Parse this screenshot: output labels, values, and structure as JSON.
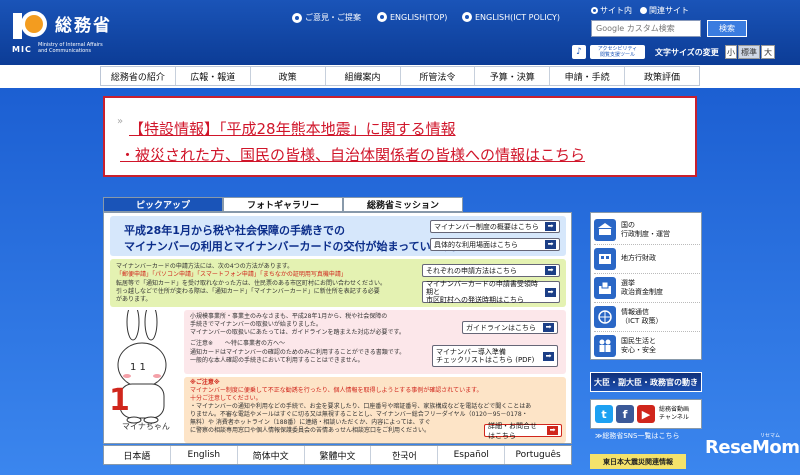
{
  "header": {
    "ministry_name": "総務省",
    "ministry_short": "MIC",
    "ministry_en_1": "Ministry of Internal Affairs",
    "ministry_en_2": "and Communications",
    "links": [
      {
        "label": "ご意見・ご提案"
      },
      {
        "label": "ENGLISH(TOP)"
      },
      {
        "label": "ENGLISH(ICT POLICY)"
      }
    ],
    "search_scope": [
      {
        "label": "サイト内",
        "selected": true
      },
      {
        "label": "関連サイト",
        "selected": false
      }
    ],
    "search_placeholder": "Google カスタム検索",
    "search_button": "検索",
    "accessibility_tool_1": "アクセシビリティ",
    "accessibility_tool_2": "閲覧支援ツール",
    "font_size_label": "文字サイズの変更",
    "font_sizes": [
      "小",
      "標準",
      "大"
    ]
  },
  "nav": [
    "総務省の紹介",
    "広報・報道",
    "政策",
    "組織案内",
    "所管法令",
    "予算・決算",
    "申請・手続",
    "政策評価"
  ],
  "alert": {
    "line1": "【特設情報】「平成28年熊本地震」に関する情報",
    "line2": "・被災された方、国民の皆様、自治体関係者の皆様への情報はこちら"
  },
  "tabs": [
    "ピックアップ",
    "フォトギャラリー",
    "総務省ミッション"
  ],
  "pickup": {
    "headline_1": "平成28年1月から税や社会保障の手続きでの",
    "headline_2": "マイナンバーの利用とマイナンバーカードの交付が始まっています。",
    "link_overview": "マイナンバー制度の概要はこちら",
    "link_scenes": "具体的な利用場面はこちら",
    "green_text": [
      "マイナンバーカードの申請方法には、次の4つの方法があります。",
      "「郵便申請」「パソコン申請」「スマートフォン申請」「まちなかの証明用写真機申請」",
      "転居等で「通知カード」を受け取れなかった方は、住民票のある市区町村にお問い合わせください。",
      "引っ越しなどで住所が変わる際は、「通知カード」「マイナンバーカード」に新住所を表記する必要",
      "があります。"
    ],
    "link_methods": "それぞれの申請方法はこちら",
    "link_receive_1": "マイナンバーカードの申請書受領時期と",
    "link_receive_2": "市区町村への発送時期はこちら",
    "pink_text": [
      "小規模事業所・事業主のみなさまも、平成28年1月から、税や社会保障の",
      "手続きでマイナンバーの取扱いが始まりました。",
      "マイナンバーの取扱いにあたっては、ガイドラインを踏まえた対応が必要です。"
    ],
    "link_guideline": "ガイドラインはこちら",
    "pink_note_title": "ご注意※　　～特に事業者の方へ～",
    "pink_note": [
      "通知カードはマイナンバーの確認のためのみに利用することができる書類です。",
      "一般的な本人確認の手続きにおいて利用することはできません。"
    ],
    "link_intro_1": "マイナンバー導入準備",
    "link_intro_2": "チェックリストはこちら (PDF)",
    "orange_title": "※ご注意※",
    "orange_text": [
      "マイナンバー制度に便乗して不正な勧誘を行ったり、個人情報を取得しようとする事例が確認されています。",
      "十分ご注意してください。",
      "・マイナンバーの通知や利用などの手続で、お金を要求したり、口座番号や暗証番号、家族構成などを電話などで聞くことはあ",
      "りません。不審な電話やメールはすぐに切る又は無視することとし、マイナンバー総合フリーダイヤル（0120－95－0178・",
      "無料）や 消費者ホットライン（188番）に連絡・相談いただくか、内容によっては、すぐ",
      "に警察の相談専用窓口や個人情報保護委員会の苦情あっせん相談窓口をご利用ください。"
    ],
    "link_details": "詳細・お問合せはこちら",
    "mascot_name": "マイナちゃん"
  },
  "languages": [
    "日本語",
    "English",
    "简体中文",
    "繁體中文",
    "한국어",
    "Español",
    "Português"
  ],
  "sidebar": [
    {
      "label1": "国の",
      "label2": "行政制度・運営",
      "icon": "government-building-icon"
    },
    {
      "label1": "地方行財政",
      "label2": "",
      "icon": "local-finance-icon"
    },
    {
      "label1": "選挙",
      "label2": "政治資金制度",
      "icon": "ballot-box-icon"
    },
    {
      "label1": "情報通信",
      "label2": "（ICT 政策）",
      "icon": "ict-network-icon"
    },
    {
      "label1": "国民生活と",
      "label2": "安心・安全",
      "icon": "family-icon"
    }
  ],
  "banner_minister": "大臣・副大臣・政務官の動き",
  "sns_channel_1": "総務省動画",
  "sns_channel_2": "チャンネル",
  "sns_link": "≫総務省SNS一覧はこちら",
  "banner_quake": "東日本大震災関連情報",
  "watermark": "ReseMom",
  "watermark_sub": "リセマム",
  "colors": {
    "header_blue": "#1a54b8",
    "alert_red": "#d0152a",
    "navy": "#0b2d8a"
  }
}
